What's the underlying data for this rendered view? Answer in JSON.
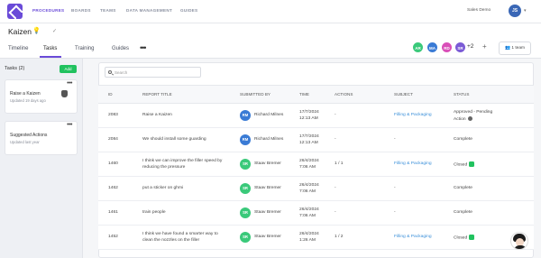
{
  "nav": {
    "items": [
      {
        "label": "PROCEDURES",
        "active": true
      },
      {
        "label": "BOARDS",
        "active": false
      },
      {
        "label": "TEAMS",
        "active": false
      },
      {
        "label": "DATA MANAGEMENT",
        "active": false
      },
      {
        "label": "GUIDES",
        "active": false
      }
    ],
    "user_name": "Sales Demo",
    "user_initials": "JS"
  },
  "header": {
    "title": "Kaizen",
    "tabs": [
      "Timeline",
      "Tasks",
      "Training",
      "Guides"
    ],
    "active_tab": "Tasks",
    "members": [
      {
        "initials": "AR",
        "color": "#3ac97a"
      },
      {
        "initials": "MA",
        "color": "#3a7bd5"
      },
      {
        "initials": "RD",
        "color": "#d94fb8"
      },
      {
        "initials": "SR",
        "color": "#7b5bd6"
      }
    ],
    "extra_members": "+2",
    "team_button": "1 team"
  },
  "sidebar": {
    "heading": "Tasks (2)",
    "add_label": "Add",
    "cards": [
      {
        "title": "Raise a Kaizen",
        "subtitle": "Updated 19 days ago"
      },
      {
        "title": "Suggested Actions",
        "subtitle": "Updated last year"
      }
    ]
  },
  "search": {
    "placeholder": "Search"
  },
  "table": {
    "headers": [
      "ID",
      "REPORT TITLE",
      "SUBMITTED BY",
      "TIME",
      "ACTIONS",
      "SUBJECT",
      "STATUS"
    ],
    "rows": [
      {
        "id": "2083",
        "title_line1": "Raise a Kaizen",
        "title_line2": "",
        "initials": "RM",
        "submitter": "Richard Milnes",
        "date": "17/7/2024",
        "time": "12:13 AM",
        "actions": "-",
        "subject": "Filling & Packaging",
        "status_line1": "Approved - Pending",
        "status_line2": "Action",
        "status_icon": "gear"
      },
      {
        "id": "2084",
        "title_line1": "We should install some guarding",
        "title_line2": "",
        "initials": "RM",
        "submitter": "Richard Milnes",
        "date": "17/7/2024",
        "time": "12:13 AM",
        "actions": "-",
        "subject": "-",
        "status_line1": "Complete",
        "status_line2": "",
        "status_icon": ""
      },
      {
        "id": "1460",
        "title_line1": "I think we can improve the filler speed by",
        "title_line2": "reducing the pressure",
        "initials": "SR",
        "submitter": "Staav Bremer",
        "date": "26/4/2024",
        "time": "7:06 AM",
        "actions": "1 / 1",
        "subject": "Filling & Packaging",
        "status_line1": "Closed",
        "status_line2": "",
        "status_icon": "green"
      },
      {
        "id": "1462",
        "title_line1": "put a sticker on ghmi",
        "title_line2": "",
        "initials": "SR",
        "submitter": "Staav Bremer",
        "date": "26/4/2024",
        "time": "7:06 AM",
        "actions": "-",
        "subject": "-",
        "status_line1": "Complete",
        "status_line2": "",
        "status_icon": ""
      },
      {
        "id": "1461",
        "title_line1": "train people",
        "title_line2": "",
        "initials": "SR",
        "submitter": "Staav Bremer",
        "date": "26/4/2024",
        "time": "7:06 AM",
        "actions": "-",
        "subject": "-",
        "status_line1": "Complete",
        "status_line2": "",
        "status_icon": ""
      },
      {
        "id": "1452",
        "title_line1": "I think we have found a smarter way to",
        "title_line2": "clean the nozzles on the filler",
        "initials": "SR",
        "submitter": "Staav Bremer",
        "date": "26/4/2024",
        "time": "1:26 AM",
        "actions": "1 / 2",
        "subject": "Filling & Packaging",
        "status_line1": "Closed",
        "status_line2": "",
        "status_icon": "green"
      }
    ]
  },
  "colors": {
    "brand": "#6a4bd8",
    "add_button": "#21c25f",
    "link": "#3a8fd9",
    "rm_badge": "#3a7bd5",
    "sr_badge": "#3ac97a"
  }
}
